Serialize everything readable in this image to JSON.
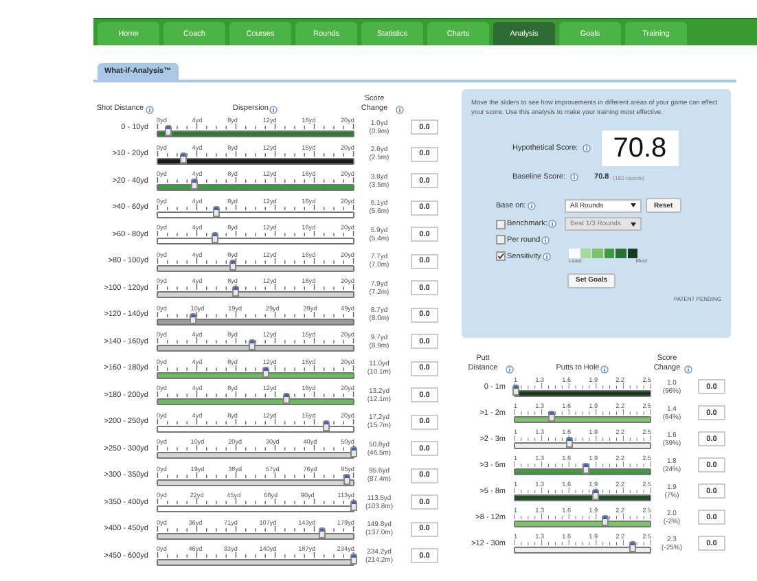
{
  "nav": [
    {
      "label": "Home",
      "selected": false
    },
    {
      "label": "Coach",
      "selected": false
    },
    {
      "label": "Courses",
      "selected": false
    },
    {
      "label": "Rounds",
      "selected": false
    },
    {
      "label": "Statistics",
      "selected": false
    },
    {
      "label": "Charts",
      "selected": false
    },
    {
      "label": "Analysis",
      "selected": true
    },
    {
      "label": "Goals",
      "selected": false
    },
    {
      "label": "Training",
      "selected": false
    }
  ],
  "page_tab": "What-if-Analysis™",
  "shot_table": {
    "columns": [
      "Shot Distance",
      "Dispersion",
      "Score Change"
    ],
    "rows": [
      {
        "distance": "0 - 10yd",
        "ticks": [
          "0yd",
          "4yd",
          "8yd",
          "12yd",
          "16yd",
          "20yd"
        ],
        "level": 0.05,
        "color": "#2f7d32",
        "reading": "1.0yd",
        "metric": "(0.9m)",
        "score_change": "0.0"
      },
      {
        "distance": ">10 - 20yd",
        "ticks": [
          "0yd",
          "4yd",
          "8yd",
          "12yd",
          "16yd",
          "20yd"
        ],
        "level": 0.13,
        "color": "#1c1c1c",
        "reading": "2.6yd",
        "metric": "(2.5m)",
        "score_change": "0.0"
      },
      {
        "distance": ">20 - 40yd",
        "ticks": [
          "0yd",
          "4yd",
          "8yd",
          "12yd",
          "16yd",
          "20yd"
        ],
        "level": 0.19,
        "color": "#3c9a3c",
        "reading": "3.8yd",
        "metric": "(3.5m)",
        "score_change": "0.0"
      },
      {
        "distance": ">40 - 60yd",
        "ticks": [
          "0yd",
          "4yd",
          "8yd",
          "12yd",
          "16yd",
          "20yd"
        ],
        "level": 0.3,
        "color": "#ffffff",
        "reading": "6.1yd",
        "metric": "(5.6m)",
        "score_change": "0.0"
      },
      {
        "distance": ">60 - 80yd",
        "ticks": [
          "0yd",
          "4yd",
          "8yd",
          "12yd",
          "16yd",
          "20yd"
        ],
        "level": 0.29,
        "color": "#ffffff",
        "reading": "5.9yd",
        "metric": "(5.4m)",
        "score_change": "0.0"
      },
      {
        "distance": ">80 - 100yd",
        "ticks": [
          "0yd",
          "4yd",
          "8yd",
          "12yd",
          "16yd",
          "20yd"
        ],
        "level": 0.385,
        "color": "#d4d4d4",
        "reading": "7.7yd",
        "metric": "(7.0m)",
        "score_change": "0.0"
      },
      {
        "distance": ">100 - 120yd",
        "ticks": [
          "0yd",
          "4yd",
          "8yd",
          "12yd",
          "16yd",
          "20yd"
        ],
        "level": 0.395,
        "color": "#d4d4d4",
        "reading": "7.9yd",
        "metric": "(7.2m)",
        "score_change": "0.0"
      },
      {
        "distance": ">120 - 140yd",
        "ticks": [
          "0yd",
          "10yd",
          "19yd",
          "29yd",
          "39yd",
          "49yd"
        ],
        "level": 0.18,
        "color": "#9a9a9a",
        "reading": "8.7yd",
        "metric": "(8.0m)",
        "score_change": "0.0"
      },
      {
        "distance": ">140 - 160yd",
        "ticks": [
          "0yd",
          "4yd",
          "8yd",
          "12yd",
          "16yd",
          "20yd"
        ],
        "level": 0.485,
        "color": "#c4c4c4",
        "reading": "9.7yd",
        "metric": "(8.9m)",
        "score_change": "0.0"
      },
      {
        "distance": ">160 - 180yd",
        "ticks": [
          "0yd",
          "4yd",
          "8yd",
          "12yd",
          "16yd",
          "20yd"
        ],
        "level": 0.55,
        "color": "#6dbb5f",
        "reading": "11.0yd",
        "metric": "(10.1m)",
        "score_change": "0.0"
      },
      {
        "distance": ">180 - 200yd",
        "ticks": [
          "0yd",
          "4yd",
          "8yd",
          "12yd",
          "16yd",
          "20yd"
        ],
        "level": 0.66,
        "color": "#6dbb5f",
        "reading": "13.2yd",
        "metric": "(12.1m)",
        "score_change": "0.0"
      },
      {
        "distance": ">200 - 250yd",
        "ticks": [
          "0yd",
          "4yd",
          "8yd",
          "12yd",
          "16yd",
          "20yd"
        ],
        "level": 0.86,
        "color": "#ffffff",
        "reading": "17.2yd",
        "metric": "(15.7m)",
        "score_change": "0.0"
      },
      {
        "distance": ">250 - 300yd",
        "ticks": [
          "0yd",
          "10yd",
          "20yd",
          "30yd",
          "40yd",
          "50yd"
        ],
        "level": 1,
        "color": "#d4d4d4",
        "reading": "50.8yd",
        "metric": "(46.5m)",
        "score_change": "0.0"
      },
      {
        "distance": ">300 - 350yd",
        "ticks": [
          "0yd",
          "19yd",
          "38yd",
          "57yd",
          "76yd",
          "95yd"
        ],
        "level": 0.97,
        "color": "#d4d4d4",
        "reading": "95.6yd",
        "metric": "(87.4m)",
        "score_change": "0.0"
      },
      {
        "distance": ">350 - 400yd",
        "ticks": [
          "0yd",
          "22yd",
          "45yd",
          "68yd",
          "90yd",
          "113yd"
        ],
        "level": 1,
        "color": "#ffffff",
        "reading": "113.5yd",
        "metric": "(103.8m)",
        "score_change": "0.0"
      },
      {
        "distance": ">400 - 450yd",
        "ticks": [
          "0yd",
          "36yd",
          "71yd",
          "107yd",
          "143yd",
          "179yd"
        ],
        "level": 0.84,
        "color": "#d4d4d4",
        "reading": "149.8yd",
        "metric": "(137.0m)",
        "score_change": "0.0"
      },
      {
        "distance": ">450 - 600yd",
        "ticks": [
          "0yd",
          "46yd",
          "93yd",
          "140yd",
          "187yd",
          "234yd"
        ],
        "level": 1,
        "color": "#d4d4d4",
        "reading": "234.2yd",
        "metric": "(214.2m)",
        "score_change": "0.0"
      }
    ]
  },
  "panel": {
    "description": "Move the sliders to see how improvements in different areas of your game can effect your score. Use this analysis to make your training most effective.",
    "hypothetical_label": "Hypothetical Score:",
    "hypothetical_score": "70.8",
    "baseline_label": "Baseline Score:",
    "baseline_score": "70.8",
    "baseline_rounds": "(182 rounds)",
    "base_on": {
      "label": "Base on:",
      "value": "All Rounds"
    },
    "reset_button": "Reset",
    "benchmark": {
      "label": "Benchmark:",
      "checked": false,
      "value": "Best 1/3 Rounds",
      "disabled": true
    },
    "per_round": {
      "label": "Per round",
      "checked": false
    },
    "sensitivity": {
      "label": "Sensitivity",
      "checked": true,
      "least": "Least",
      "most": "Most",
      "legend": [
        {
          "color": "#ffffff"
        },
        {
          "color": "#a8d89a"
        },
        {
          "color": "#7cc36a"
        },
        {
          "color": "#3f9a3f"
        },
        {
          "color": "#2a6f34"
        },
        {
          "color": "#1a3a1e"
        }
      ]
    },
    "set_goals_button": "Set Goals",
    "patent": "PATENT PENDING"
  },
  "putt_table": {
    "columns": [
      "Putt Distance",
      "Putts to Hole",
      "Score Change"
    ],
    "rows": [
      {
        "distance": "0 - 1m",
        "ticks": [
          "1",
          "1.3",
          "1.6",
          "1.9",
          "2.2",
          "2.5"
        ],
        "level": 0,
        "color": "#1a3a1e",
        "reading": "1.0",
        "metric": "(96%)",
        "score_change": "0.0"
      },
      {
        "distance": ">1 - 2m",
        "ticks": [
          "1",
          "1.3",
          "1.6",
          "1.9",
          "2.2",
          "2.5"
        ],
        "level": 0.27,
        "color": "#7cc36a",
        "reading": "1.4",
        "metric": "(64%)",
        "score_change": "0.0"
      },
      {
        "distance": ">2 - 3m",
        "ticks": [
          "1",
          "1.3",
          "1.6",
          "1.9",
          "2.2",
          "2.5"
        ],
        "level": 0.4,
        "color": "#eeeeee",
        "reading": "1.6",
        "metric": "(39%)",
        "score_change": "0.0"
      },
      {
        "distance": ">3 - 5m",
        "ticks": [
          "1",
          "1.3",
          "1.6",
          "1.9",
          "2.2",
          "2.5"
        ],
        "level": 0.53,
        "color": "#3f9a3f",
        "reading": "1.8",
        "metric": "(24%)",
        "score_change": "0.0"
      },
      {
        "distance": ">5 - 8m",
        "ticks": [
          "1",
          "1.3",
          "1.6",
          "1.9",
          "2.2",
          "2.5"
        ],
        "level": 0.6,
        "color": "#1f4f25",
        "reading": "1.9",
        "metric": "(7%)",
        "score_change": "0.0"
      },
      {
        "distance": ">8 - 12m",
        "ticks": [
          "1",
          "1.3",
          "1.6",
          "1.9",
          "2.2",
          "2.5"
        ],
        "level": 0.67,
        "color": "#7cc36a",
        "reading": "2.0",
        "metric": "(-2%)",
        "score_change": "0.0"
      },
      {
        "distance": ">12 - 30m",
        "ticks": [
          "1",
          "1.3",
          "1.6",
          "1.9",
          "2.2",
          "2.5"
        ],
        "level": 0.87,
        "color": "#eeeeee",
        "reading": "2.3",
        "metric": "(-25%)",
        "score_change": "0.0"
      }
    ]
  }
}
